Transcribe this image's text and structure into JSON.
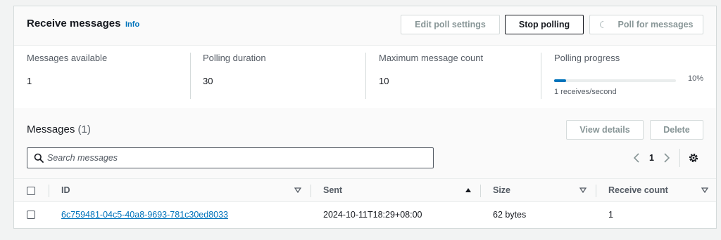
{
  "header": {
    "title": "Receive messages",
    "info": "Info",
    "buttons": {
      "edit_poll_settings": "Edit poll settings",
      "stop_polling": "Stop polling",
      "poll_for_messages": "Poll for messages"
    }
  },
  "stats": [
    {
      "label": "Messages available",
      "value": "1"
    },
    {
      "label": "Polling duration",
      "value": "30"
    },
    {
      "label": "Maximum message count",
      "value": "10"
    }
  ],
  "progress": {
    "label": "Polling progress",
    "percent_text": "10%",
    "percent": 10,
    "note": "1 receives/second"
  },
  "messages": {
    "title": "Messages",
    "count": "(1)",
    "view_details": "View details",
    "delete": "Delete",
    "search_placeholder": "Search messages",
    "page": "1",
    "columns": [
      "ID",
      "Sent",
      "Size",
      "Receive count"
    ],
    "rows": [
      {
        "id": "6c759481-04c5-40a8-9693-781c30ed8033",
        "sent": "2024-10-11T18:29+08:00",
        "size": "62 bytes",
        "receive_count": "1"
      }
    ]
  },
  "colors": {
    "link": "#0073bb",
    "progress": "#0073bb"
  }
}
